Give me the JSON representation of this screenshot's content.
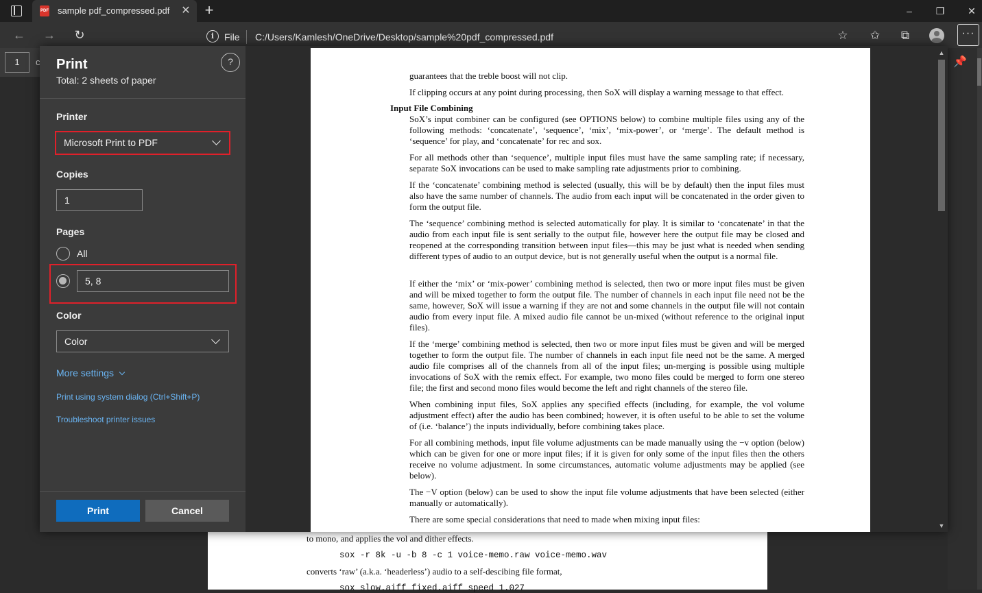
{
  "browser": {
    "tab_title": "sample pdf_compressed.pdf",
    "tab_icon_text": "PDF",
    "tab_close": "✕",
    "new_tab": "+",
    "address_scheme": "File",
    "address_url": "C:/Users/Kamlesh/OneDrive/Desktop/sample%20pdf_compressed.pdf",
    "window_controls": [
      "–",
      "❐",
      "✕"
    ]
  },
  "viewer": {
    "page_number": "1",
    "page_number_partial": "c"
  },
  "print_panel": {
    "title": "Print",
    "total": "Total: 2 sheets of paper",
    "help": "?",
    "printer_label": "Printer",
    "printer_value": "Microsoft Print to PDF",
    "copies_label": "Copies",
    "copies_value": "1",
    "pages_label": "Pages",
    "pages_all": "All",
    "pages_custom_value": "5, 8",
    "color_label": "Color",
    "color_value": "Color",
    "more_settings": "More settings",
    "system_dialog_link": "Print using system dialog (Ctrl+Shift+P)",
    "troubleshoot_link": "Troubleshoot printer issues",
    "print_button": "Print",
    "cancel_button": "Cancel",
    "accent_color": "#0f6cbd",
    "highlight_color": "#e0202a"
  },
  "preview_text": {
    "p1": "guarantees that the treble boost will not clip.",
    "p2": "If clipping occurs at any point during processing, then SoX will display a warning message to that effect.",
    "heading": "Input File Combining",
    "p3": "SoX’s input combiner can be configured (see OPTIONS below) to combine multiple files using any of the following methods: ‘concatenate’, ‘sequence’, ‘mix’, ‘mix-power’, or ‘merge’. The default method is ‘sequence’ for play, and ‘concatenate’ for rec and sox.",
    "p4": "For all methods other than ‘sequence’, multiple input files must have the same sampling rate; if necessary, separate SoX invocations can be used to make sampling rate adjustments prior to combining.",
    "p5": "If the ‘concatenate’ combining method is selected (usually, this will be by default) then the input files must also have the same number of channels. The audio from each input will be concatenated in the order given to form the output file.",
    "p6": "The ‘sequence’ combining method is selected automatically for play. It is similar to ‘concatenate’ in that the audio from each input file is sent serially to the output file, however here the output file may be closed and reopened at the corresponding transition between input files—this may be just what is needed when sending different types of audio to an output device, but is not generally useful when the output is a normal file.",
    "p7": "If either the ‘mix’ or ‘mix-power’ combining method is selected, then two or more input files must be given and will be mixed together to form the output file. The number of channels in each input file need not be the same, however, SoX will issue a warning if they are not and some channels in the output file will not contain audio from every input file. A mixed audio file cannot be un-mixed (without reference to the original input files).",
    "p8": "If the ‘merge’ combining method is selected, then two or more input files must be given and will be merged together to form the output file. The number of channels in each input file need not be the same. A merged audio file comprises all of the channels from all of the input files; un-merging is possible using multiple invocations of SoX with the remix effect. For example, two mono files could be merged to form one stereo file; the first and second mono files would become the left and right channels of the stereo file.",
    "p9": "When combining input files, SoX applies any specified effects (including, for example, the vol volume adjustment effect) after the audio has been combined; however, it is often useful to be able to set the volume of (i.e. ‘balance’) the inputs individually, before combining takes place.",
    "p10": "For all combining methods, input file volume adjustments can be made manually using the −v option (below) which can be given for one or more input files; if it is given for only some of the input files then the others receive no volume adjustment. In some circumstances, automatic volume adjustments may be applied (see below).",
    "p11": "The −V option (below) can be used to show the input file volume adjustments that have been selected (either manually or automatically).",
    "p12": "There are some special considerations that need to made when mixing input files:"
  },
  "behind_text": {
    "line1": "to mono, and applies the vol and dither effects.",
    "code1": "sox -r 8k -u -b 8 -c 1 voice-memo.raw voice-memo.wav",
    "line2": "converts ‘raw’ (a.k.a. ‘headerless’) audio to a self-descibing file format,",
    "code2": "sox slow.aiff fixed.aiff speed 1.027"
  }
}
